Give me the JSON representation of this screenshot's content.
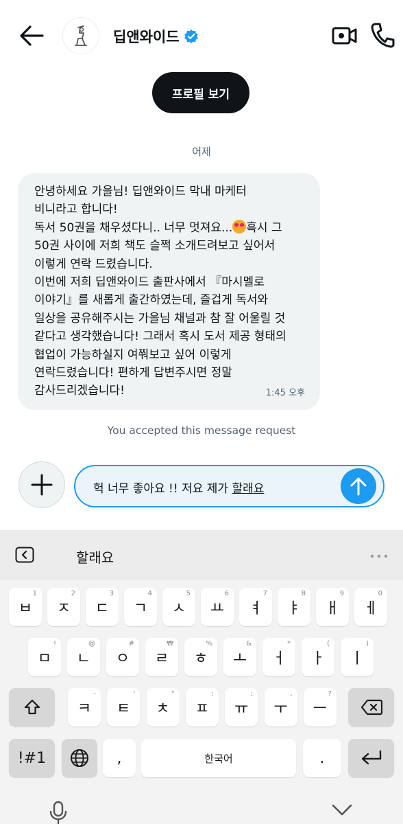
{
  "header": {
    "title": "딥앤와이드",
    "back_icon": "arrow-left-icon",
    "verified_icon": "verified-badge-icon",
    "video_icon": "video-call-icon",
    "phone_icon": "phone-icon",
    "accent_color": "#1d9bf0"
  },
  "profile_button": {
    "label": "프로필 보기"
  },
  "conversation": {
    "date_label": "어제",
    "message": {
      "lines": [
        "안녕하세요 가을님! 딥앤와이드 막내 마케터",
        "비니라고 합니다!",
        "독서 50권을 채우셨다니.. 너무 멋져요...",
        "흑시 그",
        "50권 사이에 저희 책도 슬쩍 소개드려보고 싶어서",
        "이렇게 연락 드렸습니다.",
        "이번에 저희 딥앤와이드 출판사에서 『마시멜로",
        "이야기』를 새롭게 출간하였는데, 즐겁게 독서와",
        "일상을 공유해주시는 가을님 채널과 참 잘 어울릴 것",
        "같다고 생각했습니다! 그래서 혹시 도서 제공 형태의",
        "협업이 가능하실지 여쭤보고 싶어 이렇게",
        "연락드렸습니다! 편하게 답변주시면 정말",
        "감사드리겠습니다!"
      ],
      "emoji": "heart-eyes-emoji",
      "time": "1:45 오후"
    },
    "accepted_notice": "You accepted this message request"
  },
  "composer": {
    "text_prefix": "헉 너무 좋아요 !! 저요 제가 ",
    "text_composing": "할래요",
    "plus_icon": "plus-icon",
    "send_icon": "send-arrow-up-icon"
  },
  "keyboard": {
    "suggestion": "할래요",
    "back_icon": "chevron-left-box-icon",
    "more_icon": "more-dots-icon",
    "row1": [
      {
        "key": "ㅂ",
        "hint": "1"
      },
      {
        "key": "ㅈ",
        "hint": "2"
      },
      {
        "key": "ㄷ",
        "hint": "3"
      },
      {
        "key": "ㄱ",
        "hint": "4"
      },
      {
        "key": "ㅅ",
        "hint": "5"
      },
      {
        "key": "ㅛ",
        "hint": "6"
      },
      {
        "key": "ㅕ",
        "hint": "7"
      },
      {
        "key": "ㅑ",
        "hint": "8"
      },
      {
        "key": "ㅐ",
        "hint": "9"
      },
      {
        "key": "ㅔ",
        "hint": "0"
      }
    ],
    "row2": [
      {
        "key": "ㅁ",
        "hint": "!"
      },
      {
        "key": "ㄴ",
        "hint": "@"
      },
      {
        "key": "ㅇ",
        "hint": "#"
      },
      {
        "key": "ㄹ",
        "hint": "₩"
      },
      {
        "key": "ㅎ",
        "hint": "%"
      },
      {
        "key": "ㅗ",
        "hint": "&"
      },
      {
        "key": "ㅓ",
        "hint": "*"
      },
      {
        "key": "ㅏ",
        "hint": "("
      },
      {
        "key": "ㅣ",
        "hint": ")"
      }
    ],
    "row3": [
      {
        "key": "ㅋ",
        "hint": "-"
      },
      {
        "key": "ㅌ",
        "hint": "'"
      },
      {
        "key": "ㅊ",
        "hint": "\""
      },
      {
        "key": "ㅍ",
        "hint": ":"
      },
      {
        "key": "ㅠ",
        "hint": ";"
      },
      {
        "key": "ㅜ",
        "hint": ","
      },
      {
        "key": "ㅡ",
        "hint": "?"
      }
    ],
    "shift_icon": "shift-arrow-icon",
    "backspace_icon": "backspace-icon",
    "symbols_label": "!#1",
    "globe_icon": "globe-icon",
    "comma": ",",
    "space_label": "한국어",
    "period": ".",
    "enter_icon": "enter-return-icon"
  },
  "navbar": {
    "mic_icon": "microphone-icon",
    "hide_icon": "chevron-down-icon"
  }
}
